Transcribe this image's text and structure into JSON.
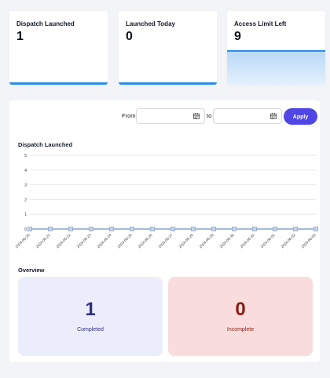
{
  "stats": [
    {
      "label": "Dispatch Launched",
      "value": "1"
    },
    {
      "label": "Launched Today",
      "value": "0"
    },
    {
      "label": "Access Limit Left",
      "value": "9"
    }
  ],
  "filter": {
    "from_label": "From",
    "to_label": "to",
    "from_value": "",
    "to_value": "",
    "apply_label": "Apply"
  },
  "chart_title": "Dispatch Launched",
  "chart_data": {
    "type": "line",
    "x": [
      "2024-05-20",
      "2024-05-21",
      "2024-05-22",
      "2024-05-23",
      "2024-05-24",
      "2024-05-25",
      "2024-05-26",
      "2024-05-27",
      "2024-05-28",
      "2024-05-29",
      "2024-05-30",
      "2024-05-31",
      "2024-06-01",
      "2024-06-02",
      "2024-06-03"
    ],
    "series": [
      {
        "values": [
          0,
          0,
          0,
          0,
          0,
          0,
          0,
          0,
          0,
          0,
          0,
          0,
          0,
          0,
          0
        ]
      }
    ],
    "yticks": [
      "0",
      "1",
      "2",
      "3",
      "4",
      "5"
    ],
    "ylim": [
      0,
      5
    ],
    "grid": true,
    "colors": {
      "line": "#8aa4c8",
      "grid": "#e6e8ee",
      "marker_fill": "#c9d7ea"
    }
  },
  "overview": {
    "title": "Overview",
    "completed": {
      "value": "1",
      "label": "Completed"
    },
    "incomplete": {
      "value": "0",
      "label": "Incomplete"
    }
  }
}
